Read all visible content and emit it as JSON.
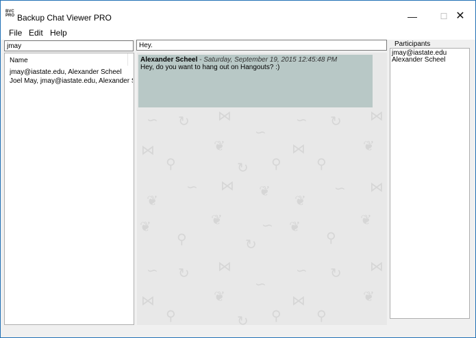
{
  "window": {
    "icon_text": "BVC PRO",
    "title": "Backup Chat Viewer PRO",
    "controls": {
      "minimize": "—",
      "maximize": "☐",
      "close": "✕"
    }
  },
  "menu": {
    "file": "File",
    "edit": "Edit",
    "help": "Help"
  },
  "search": {
    "value": "jmay"
  },
  "message_filter": {
    "value": "Hey."
  },
  "conversations": {
    "header": "Name",
    "items": [
      "jmay@iastate.edu, Alexander Scheel",
      "Joel May, jmay@iastate.edu, Alexander Sc..."
    ]
  },
  "messages": [
    {
      "author": "Alexander Scheel",
      "separator": " - ",
      "timestamp": "Saturday, September 19, 2015 12:45:48 PM",
      "text": "Hey, do you want to hang out on Hangouts? :)"
    }
  ],
  "participants": {
    "label": "Participants",
    "items": [
      "jmay@iastate.edu",
      "Alexander Scheel"
    ]
  },
  "colors": {
    "message_bg": "#b8c8c6",
    "chat_bg": "#e8e8e8",
    "window_border": "#1f6fb5"
  }
}
